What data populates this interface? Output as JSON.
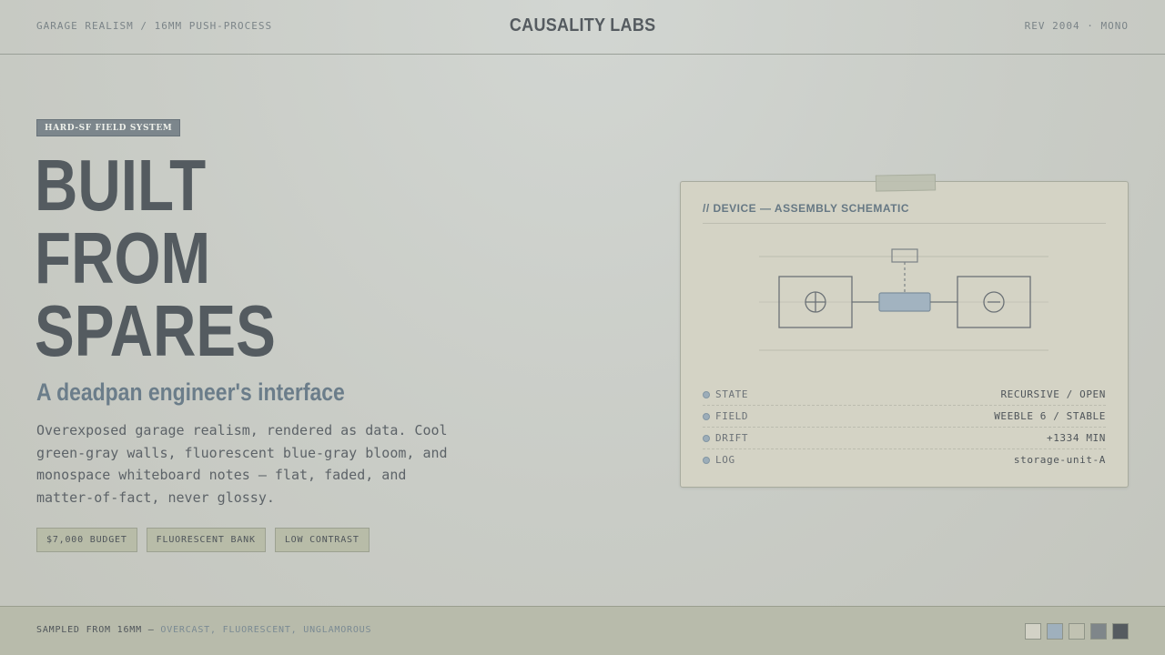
{
  "header": {
    "left": "GARAGE REALISM / 16MM PUSH-PROCESS",
    "brand": "CAUSALITY LABS",
    "right": "REV 2004 · MONO"
  },
  "hero": {
    "tag": "HARD-SF FIELD SYSTEM",
    "headline": [
      "BUILT",
      "FROM",
      "SPARES"
    ],
    "subhead": "A deadpan engineer's interface",
    "description": "Overexposed garage realism, rendered as data. Cool green-gray walls, fluorescent blue-gray bloom, and monospace whiteboard notes — flat, faded, and matter-of-fact, never glossy.",
    "chips": [
      "$7,000 BUDGET",
      "FLUORESCENT BANK",
      "LOW CONTRAST"
    ]
  },
  "card": {
    "title": "// DEVICE — ASSEMBLY SCHEMATIC",
    "stats": [
      {
        "key": "STATE",
        "value": "RECURSIVE / OPEN"
      },
      {
        "key": "FIELD",
        "value": "WEEBLE 6 / STABLE"
      },
      {
        "key": "DRIFT",
        "value": "+1334 MIN"
      },
      {
        "key": "LOG",
        "value": "storage-unit-A"
      }
    ]
  },
  "footer": {
    "prefix": "SAMPLED FROM 16MM — ",
    "suffix": "OVERCAST, FLUORESCENT, UNGLAMOROUS",
    "swatches": [
      "#d3d2c6",
      "#9fb0bd",
      "#c1c2b2",
      "#7f868a",
      "#555b60"
    ]
  }
}
